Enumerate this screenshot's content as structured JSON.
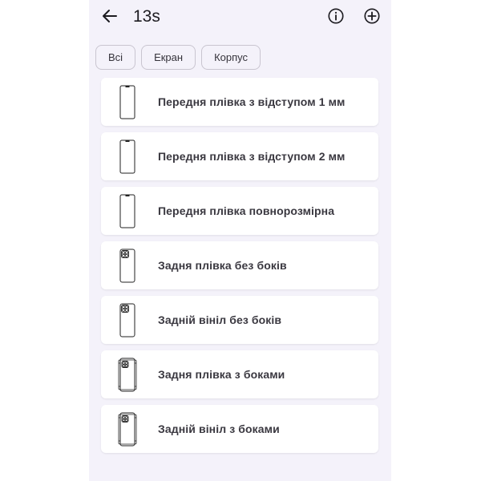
{
  "header": {
    "title": "13s",
    "back_icon": "arrow-left-icon",
    "info_icon": "info-icon",
    "add_icon": "add-icon"
  },
  "filters": [
    {
      "label": "Всі"
    },
    {
      "label": "Екран"
    },
    {
      "label": "Корпус"
    }
  ],
  "items": [
    {
      "label": "Передня плівка з відступом 1 мм",
      "icon": "phone-front-icon"
    },
    {
      "label": "Передня плівка з відступом 2 мм",
      "icon": "phone-front-icon"
    },
    {
      "label": "Передня плівка повнорозмірна",
      "icon": "phone-front-icon"
    },
    {
      "label": "Задня плівка без боків",
      "icon": "phone-back-icon"
    },
    {
      "label": "Задній вініл без боків",
      "icon": "phone-back-icon"
    },
    {
      "label": "Задня плівка з боками",
      "icon": "phone-back-sides-icon"
    },
    {
      "label": "Задній вініл з боками",
      "icon": "phone-back-sides-icon"
    }
  ],
  "colors": {
    "background": "#f4f2fa",
    "card": "#ffffff",
    "text": "#1c1b20"
  }
}
